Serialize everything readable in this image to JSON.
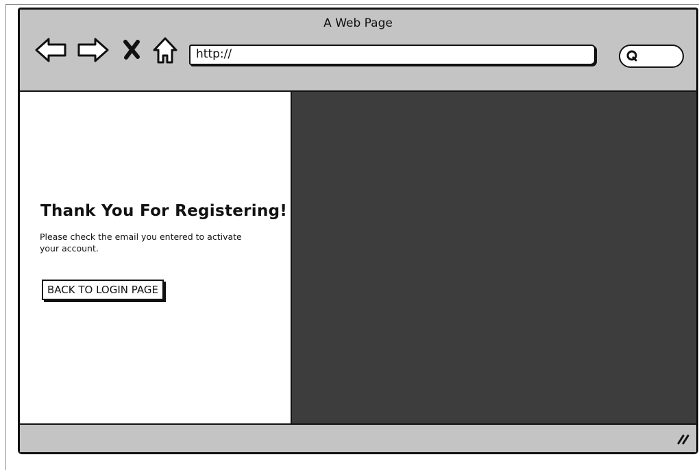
{
  "window": {
    "title": "A Web Page"
  },
  "toolbar": {
    "icons": [
      "back-arrow-icon",
      "forward-arrow-icon",
      "stop-icon",
      "home-icon"
    ],
    "url": "http://",
    "search_icon": "search-icon"
  },
  "main": {
    "heading": "Thank You For Registering!",
    "message": "Please check the email you entered to activate your account.",
    "back_button_label": "BACK TO LOGIN PAGE"
  },
  "colors": {
    "chrome": "#c4c4c4",
    "image_placeholder": "#3d3d3d",
    "stroke": "#111111"
  }
}
